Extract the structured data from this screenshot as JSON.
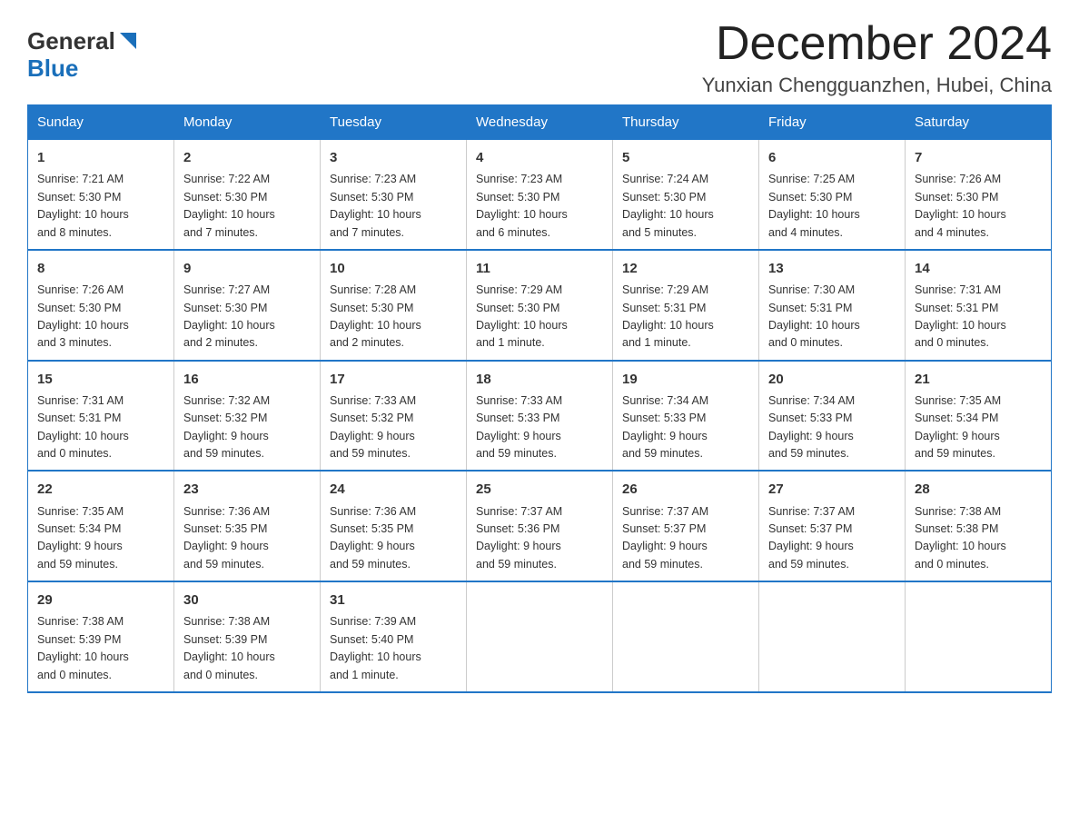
{
  "logo": {
    "text_general": "General",
    "text_blue": "Blue"
  },
  "title": "December 2024",
  "location": "Yunxian Chengguanzhen, Hubei, China",
  "days_of_week": [
    "Sunday",
    "Monday",
    "Tuesday",
    "Wednesday",
    "Thursday",
    "Friday",
    "Saturday"
  ],
  "weeks": [
    [
      {
        "day": "1",
        "info": "Sunrise: 7:21 AM\nSunset: 5:30 PM\nDaylight: 10 hours\nand 8 minutes."
      },
      {
        "day": "2",
        "info": "Sunrise: 7:22 AM\nSunset: 5:30 PM\nDaylight: 10 hours\nand 7 minutes."
      },
      {
        "day": "3",
        "info": "Sunrise: 7:23 AM\nSunset: 5:30 PM\nDaylight: 10 hours\nand 7 minutes."
      },
      {
        "day": "4",
        "info": "Sunrise: 7:23 AM\nSunset: 5:30 PM\nDaylight: 10 hours\nand 6 minutes."
      },
      {
        "day": "5",
        "info": "Sunrise: 7:24 AM\nSunset: 5:30 PM\nDaylight: 10 hours\nand 5 minutes."
      },
      {
        "day": "6",
        "info": "Sunrise: 7:25 AM\nSunset: 5:30 PM\nDaylight: 10 hours\nand 4 minutes."
      },
      {
        "day": "7",
        "info": "Sunrise: 7:26 AM\nSunset: 5:30 PM\nDaylight: 10 hours\nand 4 minutes."
      }
    ],
    [
      {
        "day": "8",
        "info": "Sunrise: 7:26 AM\nSunset: 5:30 PM\nDaylight: 10 hours\nand 3 minutes."
      },
      {
        "day": "9",
        "info": "Sunrise: 7:27 AM\nSunset: 5:30 PM\nDaylight: 10 hours\nand 2 minutes."
      },
      {
        "day": "10",
        "info": "Sunrise: 7:28 AM\nSunset: 5:30 PM\nDaylight: 10 hours\nand 2 minutes."
      },
      {
        "day": "11",
        "info": "Sunrise: 7:29 AM\nSunset: 5:30 PM\nDaylight: 10 hours\nand 1 minute."
      },
      {
        "day": "12",
        "info": "Sunrise: 7:29 AM\nSunset: 5:31 PM\nDaylight: 10 hours\nand 1 minute."
      },
      {
        "day": "13",
        "info": "Sunrise: 7:30 AM\nSunset: 5:31 PM\nDaylight: 10 hours\nand 0 minutes."
      },
      {
        "day": "14",
        "info": "Sunrise: 7:31 AM\nSunset: 5:31 PM\nDaylight: 10 hours\nand 0 minutes."
      }
    ],
    [
      {
        "day": "15",
        "info": "Sunrise: 7:31 AM\nSunset: 5:31 PM\nDaylight: 10 hours\nand 0 minutes."
      },
      {
        "day": "16",
        "info": "Sunrise: 7:32 AM\nSunset: 5:32 PM\nDaylight: 9 hours\nand 59 minutes."
      },
      {
        "day": "17",
        "info": "Sunrise: 7:33 AM\nSunset: 5:32 PM\nDaylight: 9 hours\nand 59 minutes."
      },
      {
        "day": "18",
        "info": "Sunrise: 7:33 AM\nSunset: 5:33 PM\nDaylight: 9 hours\nand 59 minutes."
      },
      {
        "day": "19",
        "info": "Sunrise: 7:34 AM\nSunset: 5:33 PM\nDaylight: 9 hours\nand 59 minutes."
      },
      {
        "day": "20",
        "info": "Sunrise: 7:34 AM\nSunset: 5:33 PM\nDaylight: 9 hours\nand 59 minutes."
      },
      {
        "day": "21",
        "info": "Sunrise: 7:35 AM\nSunset: 5:34 PM\nDaylight: 9 hours\nand 59 minutes."
      }
    ],
    [
      {
        "day": "22",
        "info": "Sunrise: 7:35 AM\nSunset: 5:34 PM\nDaylight: 9 hours\nand 59 minutes."
      },
      {
        "day": "23",
        "info": "Sunrise: 7:36 AM\nSunset: 5:35 PM\nDaylight: 9 hours\nand 59 minutes."
      },
      {
        "day": "24",
        "info": "Sunrise: 7:36 AM\nSunset: 5:35 PM\nDaylight: 9 hours\nand 59 minutes."
      },
      {
        "day": "25",
        "info": "Sunrise: 7:37 AM\nSunset: 5:36 PM\nDaylight: 9 hours\nand 59 minutes."
      },
      {
        "day": "26",
        "info": "Sunrise: 7:37 AM\nSunset: 5:37 PM\nDaylight: 9 hours\nand 59 minutes."
      },
      {
        "day": "27",
        "info": "Sunrise: 7:37 AM\nSunset: 5:37 PM\nDaylight: 9 hours\nand 59 minutes."
      },
      {
        "day": "28",
        "info": "Sunrise: 7:38 AM\nSunset: 5:38 PM\nDaylight: 10 hours\nand 0 minutes."
      }
    ],
    [
      {
        "day": "29",
        "info": "Sunrise: 7:38 AM\nSunset: 5:39 PM\nDaylight: 10 hours\nand 0 minutes."
      },
      {
        "day": "30",
        "info": "Sunrise: 7:38 AM\nSunset: 5:39 PM\nDaylight: 10 hours\nand 0 minutes."
      },
      {
        "day": "31",
        "info": "Sunrise: 7:39 AM\nSunset: 5:40 PM\nDaylight: 10 hours\nand 1 minute."
      },
      {
        "day": "",
        "info": ""
      },
      {
        "day": "",
        "info": ""
      },
      {
        "day": "",
        "info": ""
      },
      {
        "day": "",
        "info": ""
      }
    ]
  ]
}
